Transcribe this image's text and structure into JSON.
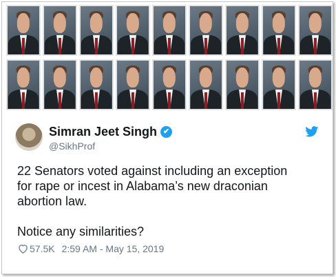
{
  "tweet": {
    "author_name": "Simran Jeet Singh",
    "author_handle": "@SikhProf",
    "verified_glyph": "✔",
    "text": "22 Senators voted against including an exception\nfor rape or incest in Alabama’s new draconian\nabortion law.\n\nNotice any similarities?",
    "likes": "57.5K",
    "timestamp": "2:59 AM - May 15, 2019"
  },
  "icons": {
    "verified": "verified-badge-icon",
    "platform": "twitter-bird-icon",
    "like": "heart-icon"
  },
  "colors": {
    "text_primary": "#14171a",
    "text_secondary": "#657786",
    "accent": "#1da1f2"
  }
}
